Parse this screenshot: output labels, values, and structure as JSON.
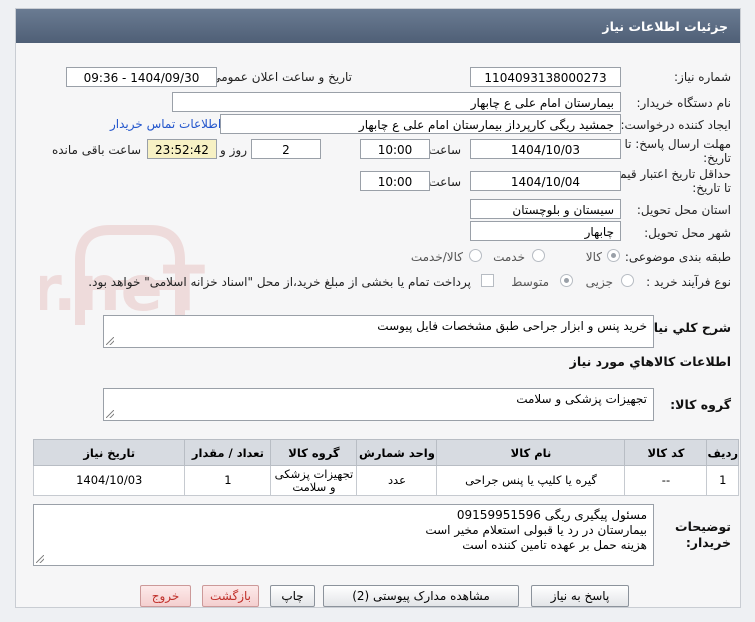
{
  "header": {
    "title": "جزئیات اطلاعات نیاز"
  },
  "form": {
    "need_number_label": "شماره نیاز:",
    "need_number": "1104093138000273",
    "announce_label": "تاریخ و ساعت اعلان عمومی:",
    "announce_value": "1404/09/30 - 09:36",
    "buyer_org_label": "نام دستگاه خریدار:",
    "buyer_org": "بیمارستان امام علی  ع  چابهار",
    "creator_label": "ایجاد کننده درخواست:",
    "creator": "جمشید ریگی کارپرداز بیمارستان امام علی  ع  چابهار",
    "buyer_contact_link": "اطلاعات تماس خریدار",
    "deadline_label": "مهلت ارسال پاسخ: تا تاریخ:",
    "deadline_date": "1404/10/03",
    "time_label": "ساعت",
    "deadline_time": "10:00",
    "days_value": "2",
    "days_label": "روز و",
    "remaining_time": "23:52:42",
    "remaining_label": "ساعت باقی مانده",
    "validity_label": "حداقل تاریخ اعتبار قیمت: تا تاریخ:",
    "validity_date": "1404/10/04",
    "validity_time": "10:00",
    "province_label": "استان محل تحویل:",
    "province": "سیستان و بلوچستان",
    "city_label": "شهر محل تحویل:",
    "city": "چابهار",
    "category_label": "طبقه بندی موضوعی:",
    "category_options": [
      "کالا",
      "خدمت",
      "کالا/خدمت"
    ],
    "process_label": "نوع فرآیند خرید :",
    "process_options": [
      "جزیی",
      "متوسط"
    ],
    "payment_note": "پرداخت تمام یا بخشی از مبلغ خرید،از محل \"اسناد خزانه اسلامی\" خواهد بود.",
    "description_label": "شرح کلي نياز:",
    "description": "خرید پنس و ابزار جراحی طبق مشخصات فایل پیوست",
    "goods_info_label": "اطلاعات کالاهاي مورد نياز",
    "goods_group_label": "گروه کالا:",
    "goods_group": "تجهیزات پزشکی و سلامت"
  },
  "table": {
    "headers": [
      "ردیف",
      "کد کالا",
      "نام کالا",
      "واحد شمارش",
      "گروه کالا",
      "تعداد / مقدار",
      "تاریخ نیاز"
    ],
    "rows": [
      [
        "1",
        "--",
        "گیره یا کلیپ یا پنس جراحی",
        "عدد",
        "تجهیزات پزشکی و سلامت",
        "1",
        "1404/10/03"
      ]
    ]
  },
  "buyer_notes": {
    "label": "توضیحات خریدار:",
    "lines": [
      "مسئول پیگیری ریگی 09159951596",
      "بیمارستان در رد یا قبولی استعلام مخیر است",
      "هزینه حمل بر عهده تامین کننده است"
    ]
  },
  "buttons": {
    "reply": "پاسخ به نیاز",
    "view_docs": "مشاهده مدارک پیوستی (2)",
    "print": "چاپ",
    "back": "بازگشت",
    "exit": "خروج"
  },
  "watermark_text": "AriaTender.neT",
  "colors": {
    "header": "#5b6b82",
    "link": "#2255cc",
    "remaining": "#f7f1c4",
    "exit": "#c0302a"
  }
}
